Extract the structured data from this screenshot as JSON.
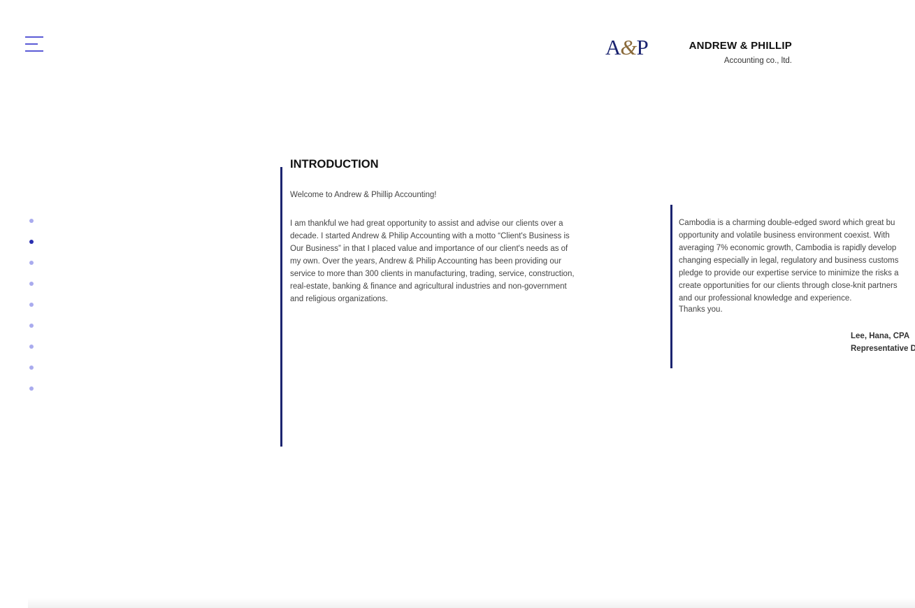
{
  "header": {
    "logo_mark_a": "A",
    "logo_mark_amp": "&",
    "logo_mark_p": "P",
    "company_name": "ANDREW & PHILLIP",
    "company_subtitle": "Accounting co., ltd."
  },
  "nav": {
    "menu_icon": "hamburger-icon",
    "dots_count": 9,
    "active_dot_index": 1
  },
  "intro": {
    "title": "INTRODUCTION",
    "welcome": "Welcome to Andrew & Phillip Accounting!",
    "paragraph_left": "I am thankful we had great opportunity to assist and advise our clients over a decade. I started Andrew & Philip Accounting with a motto “Client's Business is Our Business” in that I placed value and importance of our client's needs as of my own. Over the years, Andrew & Philip Accounting has been providing our service to more than 300 clients in manufacturing, trading, service, construction, real-estate, banking & finance and agricultural industries and non-government and religious organizations.",
    "paragraph_right": "Cambodia is a charming double-edged sword which great bu\nopportunity and volatile business environment coexist. With\naveraging 7% economic growth, Cambodia is rapidly develop\nchanging especially in legal, regulatory and business customs\npledge to provide our expertise service to minimize the risks a\ncreate opportunities for our clients through close-knit partners\nand our professional knowledge and experience.",
    "thanks": "Thanks you.",
    "signer_name": "Lee, Hana, CPA",
    "signer_title": "Representative D"
  },
  "colors": {
    "accent": "#1b2470",
    "dot_inactive": "#a9abee",
    "dot_active": "#2a2fb0",
    "menu": "#5b5bd6",
    "logo_amp": "#8a6a3a"
  }
}
